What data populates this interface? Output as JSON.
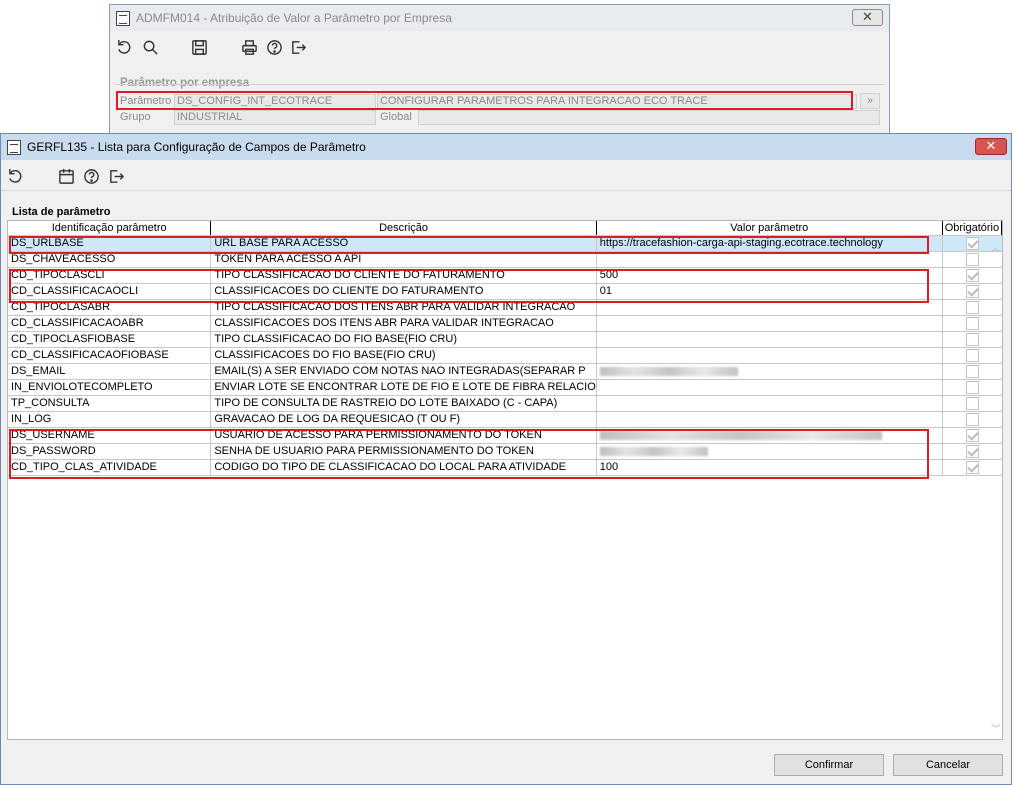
{
  "back_window": {
    "title": "ADMFM014 - Atribuição de Valor a Parâmetro por Empresa",
    "close_glyph": "✕",
    "section_title": "Parâmetro por empresa",
    "parametro_label": "Parâmetro",
    "parametro_code": "DS_CONFIG_INT_ECOTRACE",
    "parametro_desc": "CONFIGURAR PARAMETROS PARA INTEGRACAO ECO TRACE",
    "lookup_glyph": "»",
    "grupo_label": "Grupo",
    "grupo_value": "INDUSTRIAL",
    "global_label": "Global",
    "global_value": ""
  },
  "front_window": {
    "title": "GERFL135 - Lista para Configuração de Campos de Parâmetro",
    "close_glyph": "✕",
    "list_title": "Lista de parâmetro",
    "columns": [
      "Identificação parâmetro",
      "Descrição",
      "Valor parâmetro",
      "Obrigatório"
    ],
    "rows": [
      {
        "id": "DS_URLBASE",
        "desc": "URL BASE PARA ACESSO",
        "value": "https://tracefashion-carga-api-staging.ecotrace.technology",
        "required": true
      },
      {
        "id": "DS_CHAVEACESSO",
        "desc": "TOKEN PARA ACESSO A API",
        "value": "",
        "required": false
      },
      {
        "id": "CD_TIPOCLASCLI",
        "desc": "TIPO CLASSIFICACAO DO CLIENTE DO FATURAMENTO",
        "value": "500",
        "required": true
      },
      {
        "id": "CD_CLASSIFICACAOCLI",
        "desc": "CLASSIFICACOES DO CLIENTE DO FATURAMENTO",
        "value": "01",
        "required": true
      },
      {
        "id": "CD_TIPOCLASABR",
        "desc": "TIPO CLASSIFICACAO DOS ITENS ABR PARA VALIDAR INTEGRACAO",
        "value": "",
        "required": false
      },
      {
        "id": "CD_CLASSIFICACAOABR",
        "desc": "CLASSIFICACOES DOS ITENS ABR PARA VALIDAR INTEGRACAO",
        "value": "",
        "required": false
      },
      {
        "id": "CD_TIPOCLASFIOBASE",
        "desc": "TIPO CLASSIFICACAO DO FIO BASE(FIO CRU)",
        "value": "",
        "required": false
      },
      {
        "id": "CD_CLASSIFICACAOFIOBASE",
        "desc": "CLASSIFICACOES DO FIO BASE(FIO CRU)",
        "value": "",
        "required": false
      },
      {
        "id": "DS_EMAIL",
        "desc": "EMAIL(S) A SER ENVIADO COM NOTAS NAO INTEGRADAS(SEPARAR P",
        "value": "",
        "required": false
      },
      {
        "id": "IN_ENVIOLOTECOMPLETO",
        "desc": "ENVIAR LOTE SE ENCONTRAR LOTE DE FIO E LOTE DE FIBRA RELACIO",
        "value": "",
        "required": false
      },
      {
        "id": "TP_CONSULTA",
        "desc": "TIPO DE CONSULTA DE RASTREIO DO LOTE BAIXADO (C - CAPA)",
        "value": "",
        "required": false
      },
      {
        "id": "IN_LOG",
        "desc": "GRAVACAO DE LOG DA REQUESICAO (T OU F)",
        "value": "",
        "required": false
      },
      {
        "id": "DS_USERNAME",
        "desc": "USUARIO DE ACESSO PARA PERMISSIONAMENTO DO TOKEN",
        "value": "",
        "required": true
      },
      {
        "id": "DS_PASSWORD",
        "desc": "SENHA DE USUARIO PARA PERMISSIONAMENTO DO TOKEN",
        "value": "",
        "required": true
      },
      {
        "id": "CD_TIPO_CLAS_ATIVIDADE",
        "desc": "CODIGO DO TIPO DE CLASSIFICACAO DO LOCAL PARA ATIVIDADE",
        "value": "100",
        "required": true
      }
    ],
    "confirm_label": "Confirmar",
    "cancel_label": "Cancelar"
  },
  "colors": {
    "highlight": "#e01b24",
    "selected_row": "#cfe8f7",
    "titlebar_active": "#c9dbef"
  }
}
